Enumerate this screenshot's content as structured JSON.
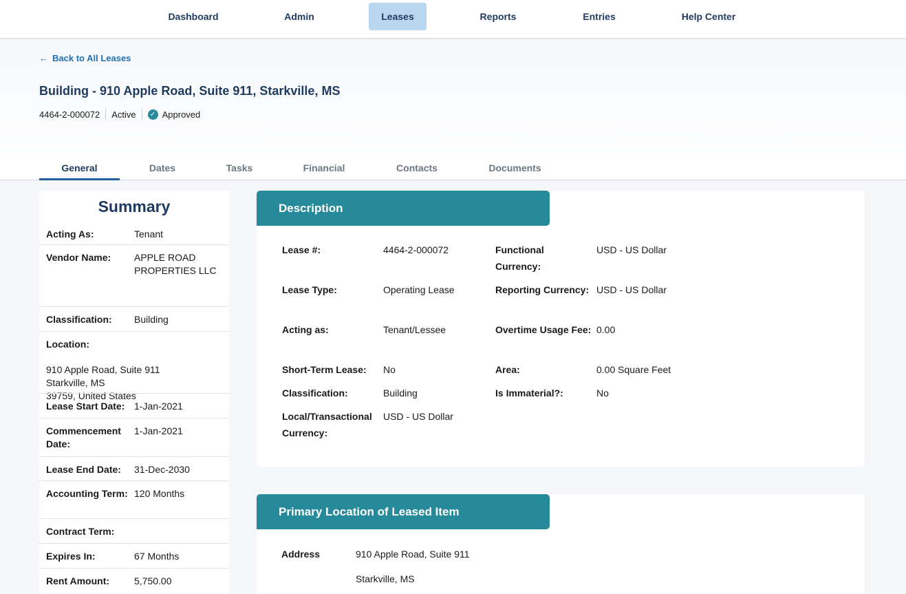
{
  "nav": {
    "dashboard": "Dashboard",
    "admin": "Admin",
    "leases": "Leases",
    "reports": "Reports",
    "entries": "Entries",
    "help_center": "Help Center"
  },
  "header": {
    "back_link": "Back to All Leases",
    "title": "Building - 910 Apple Road, Suite 911, Starkville, MS",
    "lease_id": "4464-2-000072",
    "status": "Active",
    "approval": "Approved"
  },
  "tabs": {
    "general": "General",
    "dates": "Dates",
    "tasks": "Tasks",
    "financial": "Financial",
    "contacts": "Contacts",
    "documents": "Documents"
  },
  "summary": {
    "title": "Summary",
    "acting_as_label": "Acting As:",
    "acting_as": "Tenant",
    "vendor_label": "Vendor Name:",
    "vendor": "APPLE ROAD PROPERTIES LLC",
    "classification_label": "Classification:",
    "classification": "Building",
    "location_label": "Location:",
    "location_line1": "910 Apple Road, Suite 911",
    "location_line2": "Starkville, MS",
    "location_line3": "39759, United States",
    "start_label": "Lease Start Date:",
    "start": "1-Jan-2021",
    "commencement_label": "Commencement Date:",
    "commencement": "1-Jan-2021",
    "end_label": "Lease End Date:",
    "end": "31-Dec-2030",
    "accounting_label": "Accounting Term:",
    "accounting": "120 Months",
    "contract_label": "Contract Term:",
    "expires_label": "Expires In:",
    "expires": "67 Months",
    "rent_label": "Rent Amount:",
    "rent": "5,750.00"
  },
  "description": {
    "title": "Description",
    "lease_no_label": "Lease #:",
    "lease_no": "4464-2-000072",
    "lease_type_label": "Lease Type:",
    "lease_type": "Operating Lease",
    "acting_label": "Acting as:",
    "acting": "Tenant/Lessee",
    "short_term_label": "Short-Term Lease:",
    "short_term": "No",
    "classification_label": "Classification:",
    "classification": "Building",
    "local_currency_label": "Local/Transactional Currency:",
    "local_currency": "USD - US Dollar",
    "functional_label": "Functional Currency:",
    "functional": "USD - US Dollar",
    "reporting_label": "Reporting Currency:",
    "reporting": "USD - US Dollar",
    "overtime_label": "Overtime Usage Fee:",
    "overtime": "0.00",
    "area_label": "Area:",
    "area": "0.00 Square Feet",
    "immaterial_label": "Is Immaterial?:",
    "immaterial": "No"
  },
  "location": {
    "title": "Primary Location of Leased Item",
    "address_label": "Address",
    "address_line1": "910 Apple Road, Suite 911",
    "address_line2": "Starkville, MS"
  }
}
